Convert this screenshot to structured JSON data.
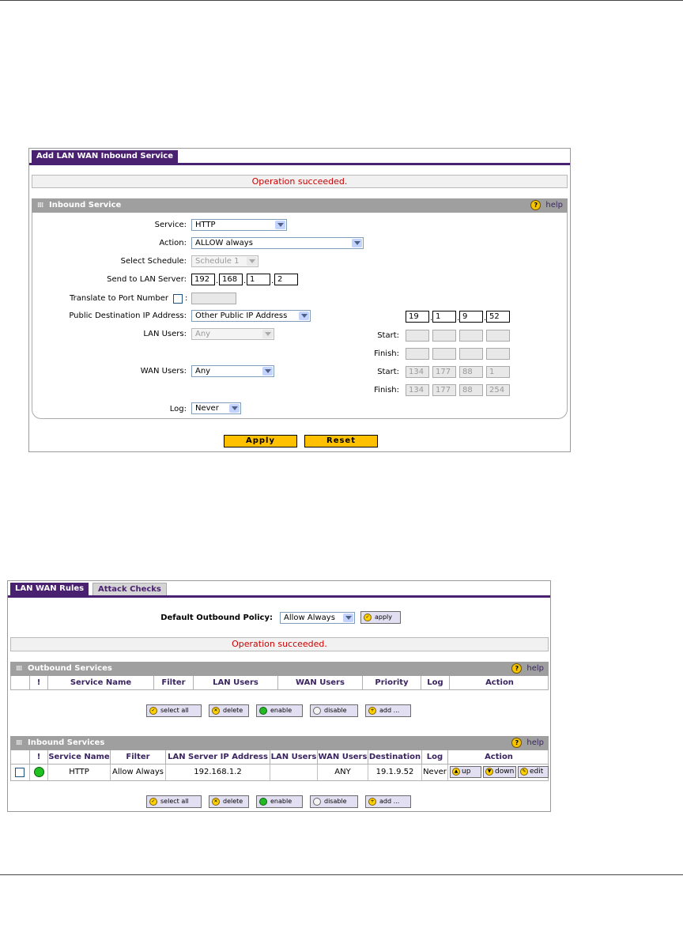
{
  "panel1": {
    "tab": "Add LAN WAN Inbound Service",
    "message": "Operation succeeded.",
    "section": "Inbound Service",
    "help": "help",
    "labels": {
      "service": "Service:",
      "action": "Action:",
      "schedule": "Select Schedule:",
      "send_to": "Send to LAN Server:",
      "translate": "Translate to Port Number",
      "public_dest": "Public Destination IP Address:",
      "lan_users": "LAN Users:",
      "wan_users": "WAN Users:",
      "log": "Log:",
      "start": "Start:",
      "finish": "Finish:"
    },
    "service_value": "HTTP",
    "action_value": "ALLOW always",
    "schedule_value": "Schedule 1",
    "send_to_ip": [
      "192",
      "168",
      "1",
      "2"
    ],
    "public_dest_value": "Other Public IP Address",
    "public_dest_ip": [
      "19",
      "1",
      "9",
      "52"
    ],
    "lan_users_value": "Any",
    "wan_users_value": "Any",
    "wan_start_ip": [
      "134",
      "177",
      "88",
      "1"
    ],
    "wan_finish_ip": [
      "134",
      "177",
      "88",
      "254"
    ],
    "log_value": "Never",
    "apply": "Apply",
    "reset": "Reset"
  },
  "panel2": {
    "tab_active": "LAN WAN Rules",
    "tab_inactive": "Attack Checks",
    "default_policy_label": "Default Outbound Policy:",
    "default_policy_value": "Allow Always",
    "apply_btn": "apply",
    "message": "Operation succeeded.",
    "outbound": {
      "title": "Outbound Services",
      "help": "help",
      "columns": [
        "!",
        "Service Name",
        "Filter",
        "LAN Users",
        "WAN Users",
        "Priority",
        "Log",
        "Action"
      ]
    },
    "inbound": {
      "title": "Inbound Services",
      "help": "help",
      "columns": [
        "!",
        "Service Name",
        "Filter",
        "LAN Server IP Address",
        "LAN Users",
        "WAN Users",
        "Destination",
        "Log",
        "Action"
      ],
      "rows": [
        {
          "service": "HTTP",
          "filter": "Allow Always",
          "lan_server": "192.168.1.2",
          "lan_users": "",
          "wan_users": "ANY",
          "destination": "19.1.9.52",
          "log": "Never",
          "up": "up",
          "down": "down",
          "edit": "edit"
        }
      ]
    },
    "buttons": {
      "select_all": "select all",
      "delete": "delete",
      "enable": "enable",
      "disable": "disable",
      "add": "add ..."
    }
  },
  "colors": {
    "accent": "#4a2170",
    "section_bar": "#9f9f9f",
    "error_text": "#cc0000",
    "button_yellow": "#ffc000"
  },
  "icons": [
    "help-icon",
    "status-enabled-icon",
    "up-arrow-icon",
    "down-arrow-icon",
    "edit-icon",
    "delete-icon",
    "check-icon",
    "add-icon"
  ]
}
